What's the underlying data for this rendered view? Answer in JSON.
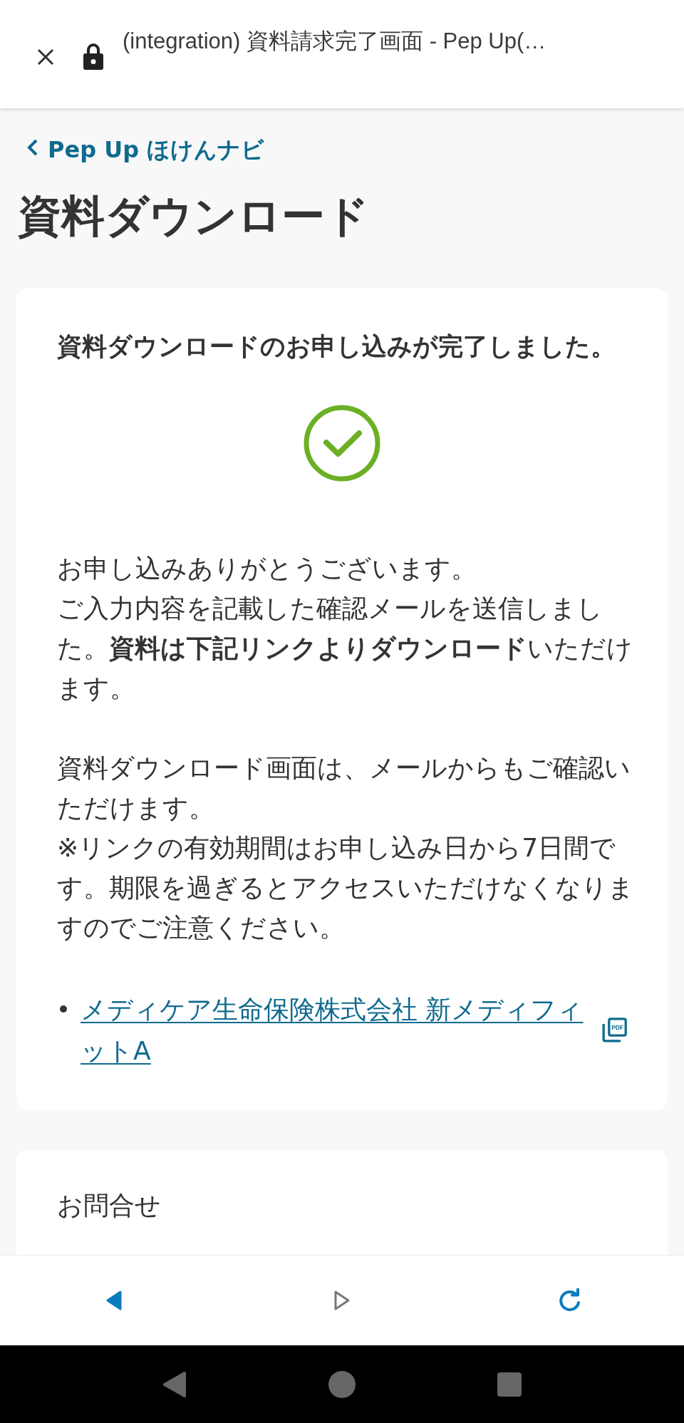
{
  "browser_bar": {
    "title": "(integration) 資料請求完了画面 - Pep Up(…"
  },
  "back_link": {
    "label": "Pep Up ほけんナビ"
  },
  "page_title": "資料ダウンロード",
  "completion_card": {
    "heading": "資料ダウンロードのお申し込みが完了しました。",
    "paragraphs": [
      [
        "お申し込みありがとうございます。",
        "ご入力内容を記載した確認メールを送信しました。**資料は下記リンクよりダウンロード**いただけます。"
      ],
      [
        "資料ダウンロード画面は、メールからもご確認いただけます。",
        "※リンクの有効期間はお申し込み日から7日間です。期限を過ぎるとアクセスいただけなくなりますのでご注意ください。"
      ]
    ],
    "documents": [
      {
        "label": "メディケア生命保険株式会社 新メディフィットA",
        "badge": "PDF"
      }
    ]
  },
  "contact_card": {
    "heading": "お問合せ"
  },
  "toolbar": {
    "buttons": [
      {
        "kind": "back",
        "disabled": false
      },
      {
        "kind": "forward",
        "disabled": true
      },
      {
        "kind": "reload",
        "disabled": false
      }
    ]
  },
  "system_nav": {
    "buttons": [
      {
        "kind": "back"
      },
      {
        "kind": "home"
      },
      {
        "kind": "recents"
      }
    ]
  }
}
